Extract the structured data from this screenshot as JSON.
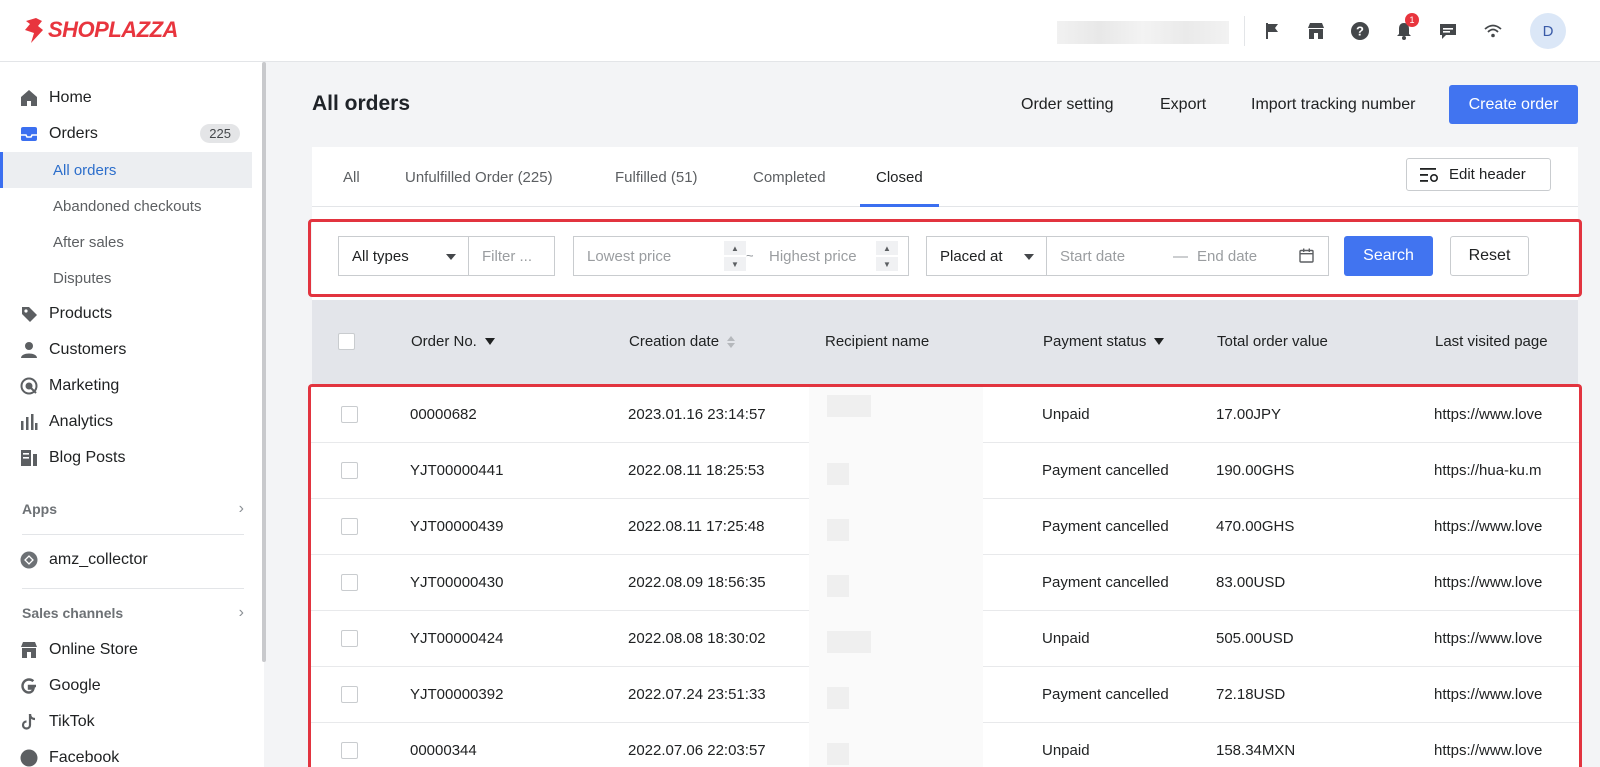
{
  "app": {
    "brand": "SHOPLAZZA",
    "brand_color": "#e8353e",
    "accent_color": "#4174f0",
    "highlight_color": "#e2343f"
  },
  "topbar": {
    "icons": [
      "flag-icon",
      "store-icon",
      "help-icon",
      "bell-icon",
      "chat-icon",
      "wifi-icon"
    ],
    "notification_count": "1",
    "avatar_initial": "D"
  },
  "sidebar": {
    "home": "Home",
    "orders": "Orders",
    "orders_count": "225",
    "all_orders": "All orders",
    "abandoned": "Abandoned checkouts",
    "after_sales": "After sales",
    "disputes": "Disputes",
    "products": "Products",
    "customers": "Customers",
    "marketing": "Marketing",
    "analytics": "Analytics",
    "blog_posts": "Blog Posts",
    "apps_heading": "Apps",
    "app_item": "amz_collector",
    "sales_heading": "Sales channels",
    "online_store": "Online Store",
    "google": "Google",
    "tiktok": "TikTok",
    "facebook": "Facebook"
  },
  "main": {
    "title": "All orders",
    "actions": {
      "order_setting": "Order setting",
      "export": "Export",
      "import_tracking": "Import tracking number",
      "create_order": "Create order"
    },
    "tabs": [
      {
        "label": "All"
      },
      {
        "label": "Unfulfilled Order",
        "count": "(225)"
      },
      {
        "label": "Fulfilled",
        "count": "(51)"
      },
      {
        "label": "Completed"
      },
      {
        "label": "Closed"
      }
    ],
    "active_tab": "Closed",
    "edit_header": "Edit header"
  },
  "filters": {
    "type_select": "All types",
    "filter_placeholder": "Filter ...",
    "lowest_price_placeholder": "Lowest price",
    "range_separator": "~",
    "highest_price_placeholder": "Highest price",
    "date_type_select": "Placed at",
    "start_date_placeholder": "Start date",
    "date_separator": "—",
    "end_date_placeholder": "End date",
    "search": "Search",
    "reset": "Reset"
  },
  "table": {
    "columns": [
      "Order No.",
      "Creation date",
      "Recipient name",
      "Payment status",
      "Total order value",
      "Last visited page"
    ],
    "rows": [
      {
        "order_no": "00000682",
        "date": "2023.01.16 23:14:57",
        "status": "Unpaid",
        "total": "17.00JPY",
        "page": "https://www.love"
      },
      {
        "order_no": "YJT00000441",
        "date": "2022.08.11 18:25:53",
        "status": "Payment cancelled",
        "total": "190.00GHS",
        "page": "https://hua-ku.m"
      },
      {
        "order_no": "YJT00000439",
        "date": "2022.08.11 17:25:48",
        "status": "Payment cancelled",
        "total": "470.00GHS",
        "page": "https://www.love"
      },
      {
        "order_no": "YJT00000430",
        "date": "2022.08.09 18:56:35",
        "status": "Payment cancelled",
        "total": "83.00USD",
        "page": "https://www.love"
      },
      {
        "order_no": "YJT00000424",
        "date": "2022.08.08 18:30:02",
        "status": "Unpaid",
        "total": "505.00USD",
        "page": "https://www.love"
      },
      {
        "order_no": "YJT00000392",
        "date": "2022.07.24 23:51:33",
        "status": "Payment cancelled",
        "total": "72.18USD",
        "page": "https://www.love"
      },
      {
        "order_no": "00000344",
        "date": "2022.07.06 22:03:57",
        "status": "Unpaid",
        "total": "158.34MXN",
        "page": "https://www.love"
      }
    ]
  }
}
